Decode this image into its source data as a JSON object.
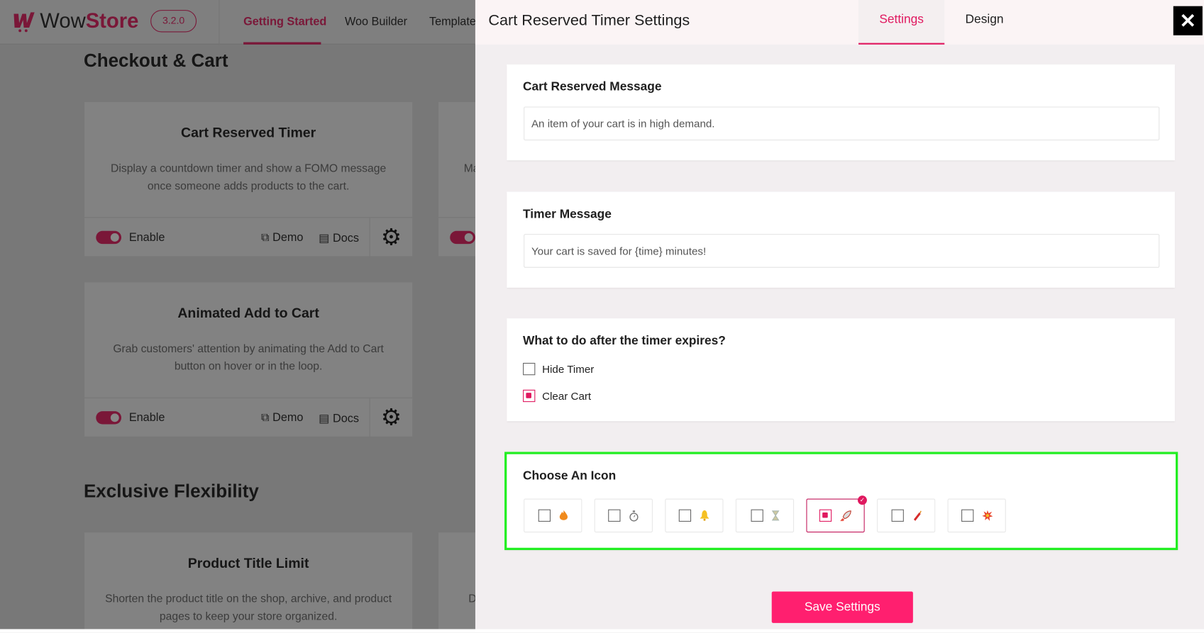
{
  "app": {
    "logo_prefix": "Wow",
    "logo_suffix": "Store",
    "version": "3.2.0",
    "nav": [
      "Getting Started",
      "Woo Builder",
      "Template"
    ]
  },
  "sections": [
    "Checkout & Cart",
    "Exclusive Flexibility"
  ],
  "cards": [
    {
      "title": "Cart Reserved Timer",
      "desc": "Display a countdown timer and show a FOMO message once someone adds products to the cart.",
      "enable": "Enable",
      "demo": "Demo",
      "docs": "Docs",
      "enabled": true
    },
    {
      "title": "Animated Add to Cart",
      "desc": "Grab customers' attention by animating the Add to Cart button on hover or in the loop.",
      "enable": "Enable",
      "demo": "Demo",
      "docs": "Docs",
      "enabled": true
    },
    {
      "title": "Product Title Limit",
      "desc": "Shorten the product title on the shop, archive, and product pages to keep your store organized."
    }
  ],
  "partial": {
    "text1": "Ma",
    "text2": "D"
  },
  "panel": {
    "title": "Cart Reserved Timer Settings",
    "tabs": [
      "Settings",
      "Design"
    ],
    "active_tab": "Settings",
    "close": "✕",
    "cart_message": {
      "label": "Cart Reserved Message",
      "value": "An item of your cart is in high demand."
    },
    "timer_message": {
      "label": "Timer Message",
      "value": "Your cart is saved for {time} minutes!"
    },
    "expire": {
      "label": "What to do after the timer expires?",
      "options": [
        {
          "label": "Hide Timer",
          "checked": false
        },
        {
          "label": "Clear Cart",
          "checked": true
        }
      ]
    },
    "icon_choice": {
      "label": "Choose An Icon",
      "icons": [
        "fire-icon",
        "stopwatch-icon",
        "bell-icon",
        "hourglass-icon",
        "rocket-icon",
        "dynamite-icon",
        "explosion-icon"
      ],
      "selected": "rocket-icon"
    },
    "save": "Save Settings"
  },
  "colors": {
    "accent": "#e0185f",
    "highlight": "#22ee22"
  }
}
